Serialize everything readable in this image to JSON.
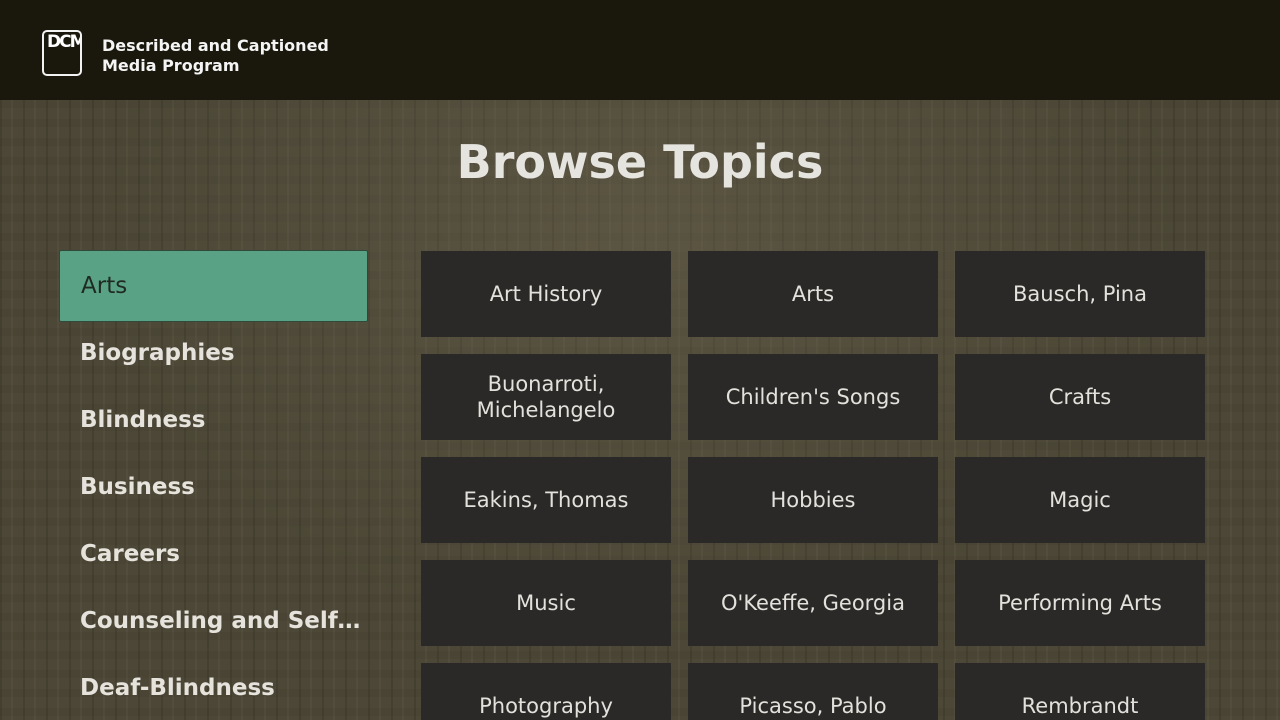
{
  "header": {
    "logo_text": "DCMP",
    "brand_line1": "Described and Captioned",
    "brand_line2": "Media Program"
  },
  "page": {
    "title": "Browse Topics"
  },
  "sidebar": {
    "items": [
      {
        "label": "Arts",
        "selected": true
      },
      {
        "label": "Biographies",
        "selected": false
      },
      {
        "label": "Blindness",
        "selected": false
      },
      {
        "label": "Business",
        "selected": false
      },
      {
        "label": "Careers",
        "selected": false
      },
      {
        "label": "Counseling and Self-...",
        "selected": false
      },
      {
        "label": "Deaf-Blindness",
        "selected": false
      }
    ]
  },
  "topics": {
    "tiles": [
      {
        "label": "Art History"
      },
      {
        "label": "Arts"
      },
      {
        "label": "Bausch, Pina"
      },
      {
        "label": "Buonarroti, Michelangelo"
      },
      {
        "label": "Children's Songs"
      },
      {
        "label": "Crafts"
      },
      {
        "label": "Eakins, Thomas"
      },
      {
        "label": "Hobbies"
      },
      {
        "label": "Magic"
      },
      {
        "label": "Music"
      },
      {
        "label": "O'Keeffe, Georgia"
      },
      {
        "label": "Performing Arts"
      },
      {
        "label": "Photography"
      },
      {
        "label": "Picasso, Pablo"
      },
      {
        "label": "Rembrandt"
      }
    ]
  },
  "colors": {
    "header_bg": "#1a170c",
    "selected_bg": "#5aa286",
    "tile_bg": "#2b2927",
    "text": "#e6e3dc"
  }
}
